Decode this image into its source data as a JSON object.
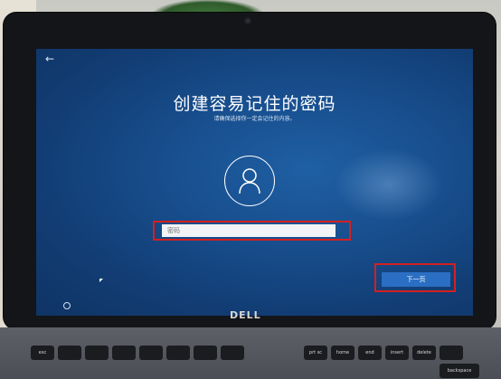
{
  "setup_screen": {
    "back_label": "←",
    "title": "创建容易记住的密码",
    "subtitle": "请确保选择你一定会记住的内容。",
    "password_placeholder": "密码",
    "next_label": "下一页"
  },
  "hardware": {
    "brand": "DELL"
  },
  "keyboard": {
    "keys": [
      "esc",
      "",
      "",
      "",
      "",
      "",
      "",
      "",
      "prt sc",
      "home",
      "end",
      "insert",
      "delete",
      "",
      "backspace"
    ]
  },
  "colors": {
    "screen_bg": "#184f8f",
    "button_bg": "#2a6fc4",
    "highlight": "#d42020"
  },
  "icons": {
    "avatar": "user-icon",
    "back": "back-arrow-icon",
    "accessibility": "accessibility-icon"
  }
}
